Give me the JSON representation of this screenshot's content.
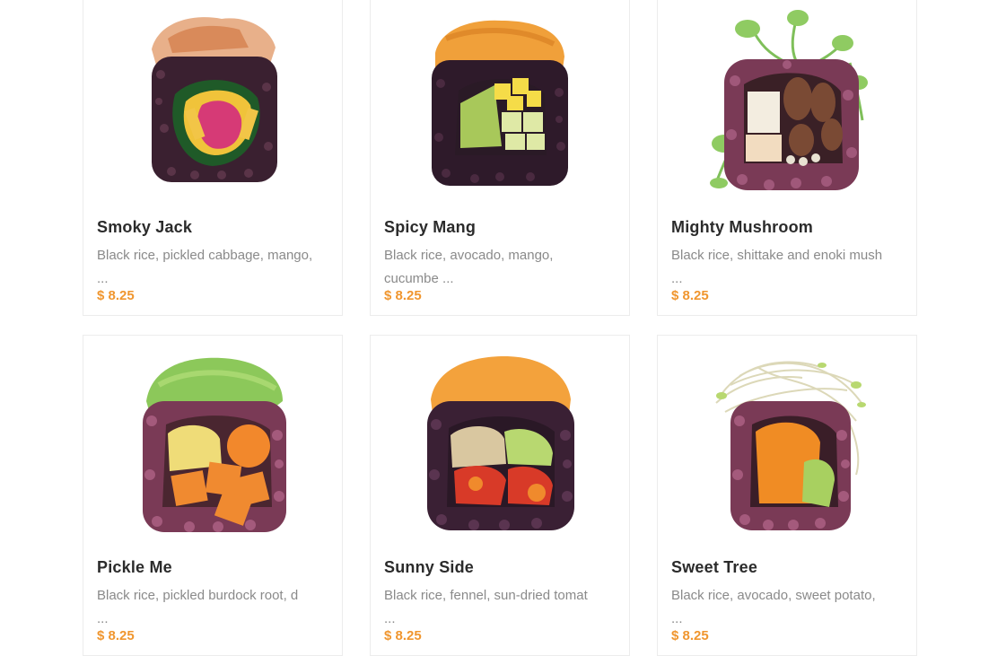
{
  "menu": {
    "items": [
      {
        "name": "Smoky Jack",
        "desc_line1": "Black rice, pickled cabbage, mango,",
        "desc_line2": "...",
        "price": "$ 8.25",
        "image_icon": "smoky-jack-sushi-icon"
      },
      {
        "name": "Spicy Mang",
        "desc_line1": "Black rice, avocado, mango,",
        "desc_line2": "cucumbe ...",
        "price": "$ 8.25",
        "image_icon": "spicy-mang-sushi-icon"
      },
      {
        "name": "Mighty Mushroom",
        "desc_line1": "Black rice, shittake and enoki mush",
        "desc_line2": "...",
        "price": "$ 8.25",
        "image_icon": "mighty-mushroom-sushi-icon"
      },
      {
        "name": "Pickle Me",
        "desc_line1": "Black rice, pickled burdock root, d",
        "desc_line2": "...",
        "price": "$ 8.25",
        "image_icon": "pickle-me-sushi-icon"
      },
      {
        "name": "Sunny Side",
        "desc_line1": "Black rice, fennel, sun-dried tomat",
        "desc_line2": "...",
        "price": "$ 8.25",
        "image_icon": "sunny-side-sushi-icon"
      },
      {
        "name": "Sweet Tree",
        "desc_line1": "Black rice, avocado, sweet potato,",
        "desc_line2": "...",
        "price": "$ 8.25",
        "image_icon": "sweet-tree-sushi-icon"
      }
    ]
  },
  "colors": {
    "price": "#f0962f",
    "title": "#2b2b2b",
    "description": "#8a8a8a",
    "card_border": "#ececec"
  }
}
